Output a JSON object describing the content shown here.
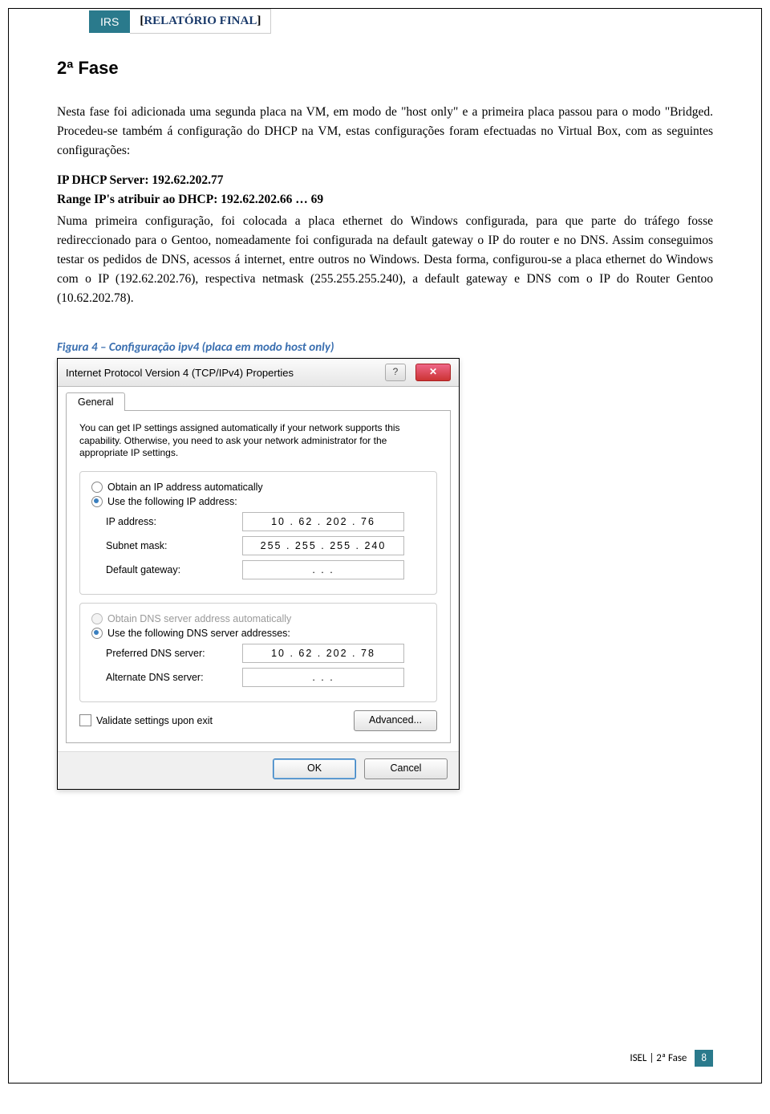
{
  "header": {
    "tab_code": "IRS",
    "tab_title": "RELATÓRIO FINAL"
  },
  "section_title": "2ª Fase",
  "para1": "Nesta fase foi adicionada uma segunda placa na VM, em modo de \"host only\" e a primeira placa passou para o modo \"Bridged. Procedeu-se também á configuração do DHCP na VM, estas configurações foram efectuadas  no Virtual Box, com as seguintes configurações:",
  "line_ip_server": "IP DHCP Server: 192.62.202.77",
  "line_range": "Range IP's atribuir ao DHCP: 192.62.202.66 … 69",
  "para2": "Numa primeira configuração, foi colocada a placa ethernet do Windows configurada, para que parte do tráfego fosse redireccionado para o Gentoo, nomeadamente foi configurada na default gateway o IP do router e no DNS. Assim conseguimos testar os pedidos de DNS, acessos á internet, entre outros no Windows. Desta forma, configurou-se a placa ethernet do Windows com o IP (192.62.202.76), respectiva netmask (255.255.255.240), a default gateway e DNS com o IP do Router Gentoo (10.62.202.78).",
  "figure_caption": "Figura  4 – Configuração ipv4 (placa em modo host only)",
  "dialog": {
    "title": "Internet Protocol Version 4 (TCP/IPv4) Properties",
    "tab_general": "General",
    "intro": "You can get IP settings assigned automatically if your network supports this capability. Otherwise, you need to ask your network administrator for the appropriate IP settings.",
    "radio_obtain_ip": "Obtain an IP address automatically",
    "radio_use_ip": "Use the following IP address:",
    "lbl_ip": "IP address:",
    "val_ip": "10 . 62 . 202 . 76",
    "lbl_mask": "Subnet mask:",
    "val_mask": "255 . 255 . 255 . 240",
    "lbl_gw": "Default gateway:",
    "val_gw": ".       .       .",
    "radio_obtain_dns": "Obtain DNS server address automatically",
    "radio_use_dns": "Use the following DNS server addresses:",
    "lbl_pref_dns": "Preferred DNS server:",
    "val_pref_dns": "10 . 62 . 202 . 78",
    "lbl_alt_dns": "Alternate DNS server:",
    "val_alt_dns": ".       .       .",
    "chk_validate": "Validate settings upon exit",
    "btn_advanced": "Advanced...",
    "btn_ok": "OK",
    "btn_cancel": "Cancel",
    "help_glyph": "?",
    "close_glyph": "✕"
  },
  "footer": {
    "left": "ISEL | 2ª Fase",
    "pagenum": "8"
  }
}
